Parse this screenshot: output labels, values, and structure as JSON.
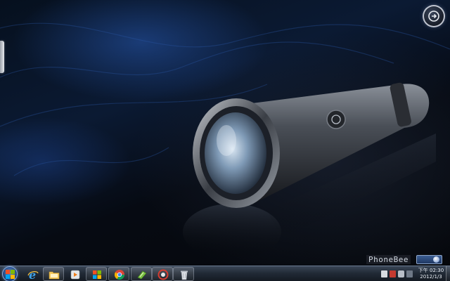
{
  "desktop": {
    "watermark_text": "PhoneBee",
    "gadget_icon": "power-icon"
  },
  "taskbar": {
    "start_icon": "windows-logo-icon",
    "pinned_items": [
      {
        "name": "internet-explorer",
        "icon": "ie-icon"
      },
      {
        "name": "file-explorer",
        "icon": "folder-icon"
      },
      {
        "name": "media-player",
        "icon": "media-player-icon"
      },
      {
        "name": "windows-logo",
        "icon": "windows-flag-icon"
      },
      {
        "name": "chrome",
        "icon": "chrome-icon"
      },
      {
        "name": "app-green",
        "icon": "green-app-icon"
      },
      {
        "name": "app-circle",
        "icon": "circle-app-icon"
      },
      {
        "name": "recycle-bin",
        "icon": "trash-icon"
      }
    ],
    "clock": {
      "time": "下午 02:30",
      "date": "2012/1/3"
    }
  },
  "colors": {
    "taskbar_top": "#3a4657",
    "taskbar_bottom": "#141a22",
    "accent_blue": "#2f6fc4"
  }
}
